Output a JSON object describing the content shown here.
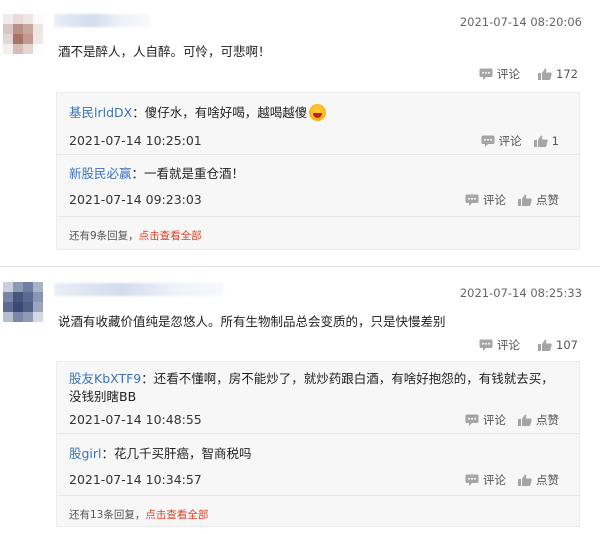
{
  "comments": [
    {
      "time": "2021-07-14 08:20:06",
      "text": "酒不是醉人，人自醉。可怜，可悲啊！",
      "comment_label": "评论",
      "likes": "172",
      "replies": [
        {
          "user": "基民lrldDX",
          "text": "：傻仔水，有啥好喝，越喝越傻",
          "time": "2021-07-14 10:25:01",
          "comment_label": "评论",
          "likes": "1"
        },
        {
          "user": "新股民必赢",
          "text": "：一看就是重仓酒！",
          "time": "2021-07-14 09:23:03",
          "comment_label": "评论",
          "likes": "点赞"
        }
      ],
      "more_prefix": "还有9条回复，",
      "more_link": "点击查看全部"
    },
    {
      "time": "2021-07-14 08:25:33",
      "text": "说酒有收藏价值纯是忽悠人。所有生物制品总会变质的，只是快慢差别",
      "comment_label": "评论",
      "likes": "107",
      "replies": [
        {
          "user": "股友KbXTF9",
          "text": "：还看不懂啊，房不能炒了，就炒药跟白酒，有啥好抱怨的，有钱就去买，没钱别瞎BB",
          "time": "2021-07-14 10:48:55",
          "comment_label": "评论",
          "likes": "点赞"
        },
        {
          "user": "股girl",
          "text": "：花几千买肝癌，智商税吗",
          "time": "2021-07-14 10:34:57",
          "comment_label": "评论",
          "likes": "点赞"
        }
      ],
      "more_prefix": "还有13条回复，",
      "more_link": "点击查看全部"
    }
  ],
  "icons": {
    "comment": "comment-icon",
    "like": "thumbs-up-icon",
    "emoji": "laughing-emoji-icon"
  },
  "colors": {
    "username": "#3a72c0",
    "more_link": "#e0402a"
  }
}
